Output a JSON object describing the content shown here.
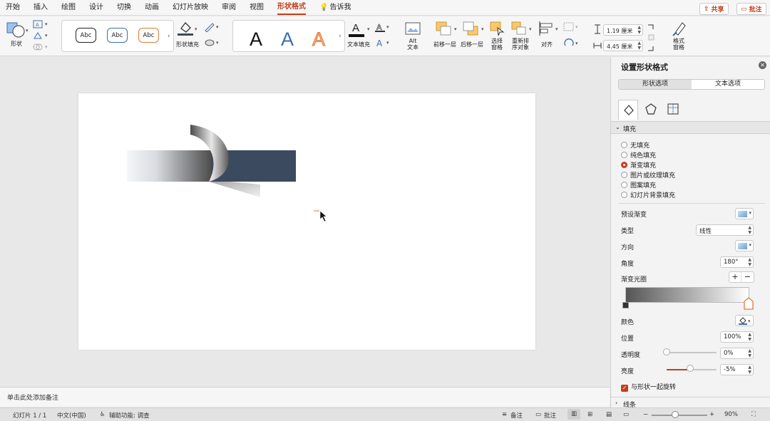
{
  "tabs": [
    "开始",
    "插入",
    "绘图",
    "设计",
    "切换",
    "动画",
    "幻灯片放映",
    "审阅",
    "视图",
    "形状格式",
    "告诉我"
  ],
  "active_tab": "形状格式",
  "top_buttons": {
    "share": "共享",
    "comment": "批注"
  },
  "ribbon": {
    "shapes_label": "形状",
    "style_samples": [
      "Abc",
      "Abc",
      "Abc"
    ],
    "shape_fill_label": "形状填充",
    "wordart_samples": [
      "A",
      "A",
      "A"
    ],
    "text_fill_label": "文本填充",
    "alt_text_label": "Alt\n文本",
    "bring_forward_label": "前移一层",
    "send_backward_label": "后移一层",
    "selection_pane_label": "选择\n窗格",
    "reorder_label": "重新排\n序对象",
    "align_label": "对齐",
    "height_value": "1.19 厘米",
    "width_value": "4.45 厘米",
    "format_pane_label": "格式\n窗格"
  },
  "notes_placeholder": "单击此处添加备注",
  "status": {
    "slide": "幻灯片 1 / 1",
    "language": "中文(中国)",
    "accessibility": "辅助功能: 调查",
    "notes": "备注",
    "comments": "批注",
    "zoom": "90%"
  },
  "pane": {
    "title": "设置形状格式",
    "tab_shape": "形状选项",
    "tab_text": "文本选项",
    "fill_section": "填充",
    "fill_options": [
      "无填充",
      "纯色填充",
      "渐变填充",
      "图片或纹理填充",
      "图案填充",
      "幻灯片背景填充"
    ],
    "selected_fill": "渐变填充",
    "preset_gradient_label": "预设渐变",
    "type_label": "类型",
    "type_value": "线性",
    "direction_label": "方向",
    "angle_label": "角度",
    "angle_value": "180°",
    "gradient_stops_label": "渐变光圈",
    "color_label": "颜色",
    "position_label": "位置",
    "position_value": "100%",
    "transparency_label": "透明度",
    "transparency_value": "0%",
    "transparency_level": 0,
    "brightness_label": "亮度",
    "brightness_value": "-5%",
    "brightness_level": 0.47,
    "rotate_with_shape_label": "与形状一起旋转",
    "line_section": "线条"
  },
  "colors": {
    "accent": "#c43e1c",
    "shape_dark": "#3b4a5e",
    "gradient_start": "#555555",
    "gradient_end": "#ffffff"
  }
}
